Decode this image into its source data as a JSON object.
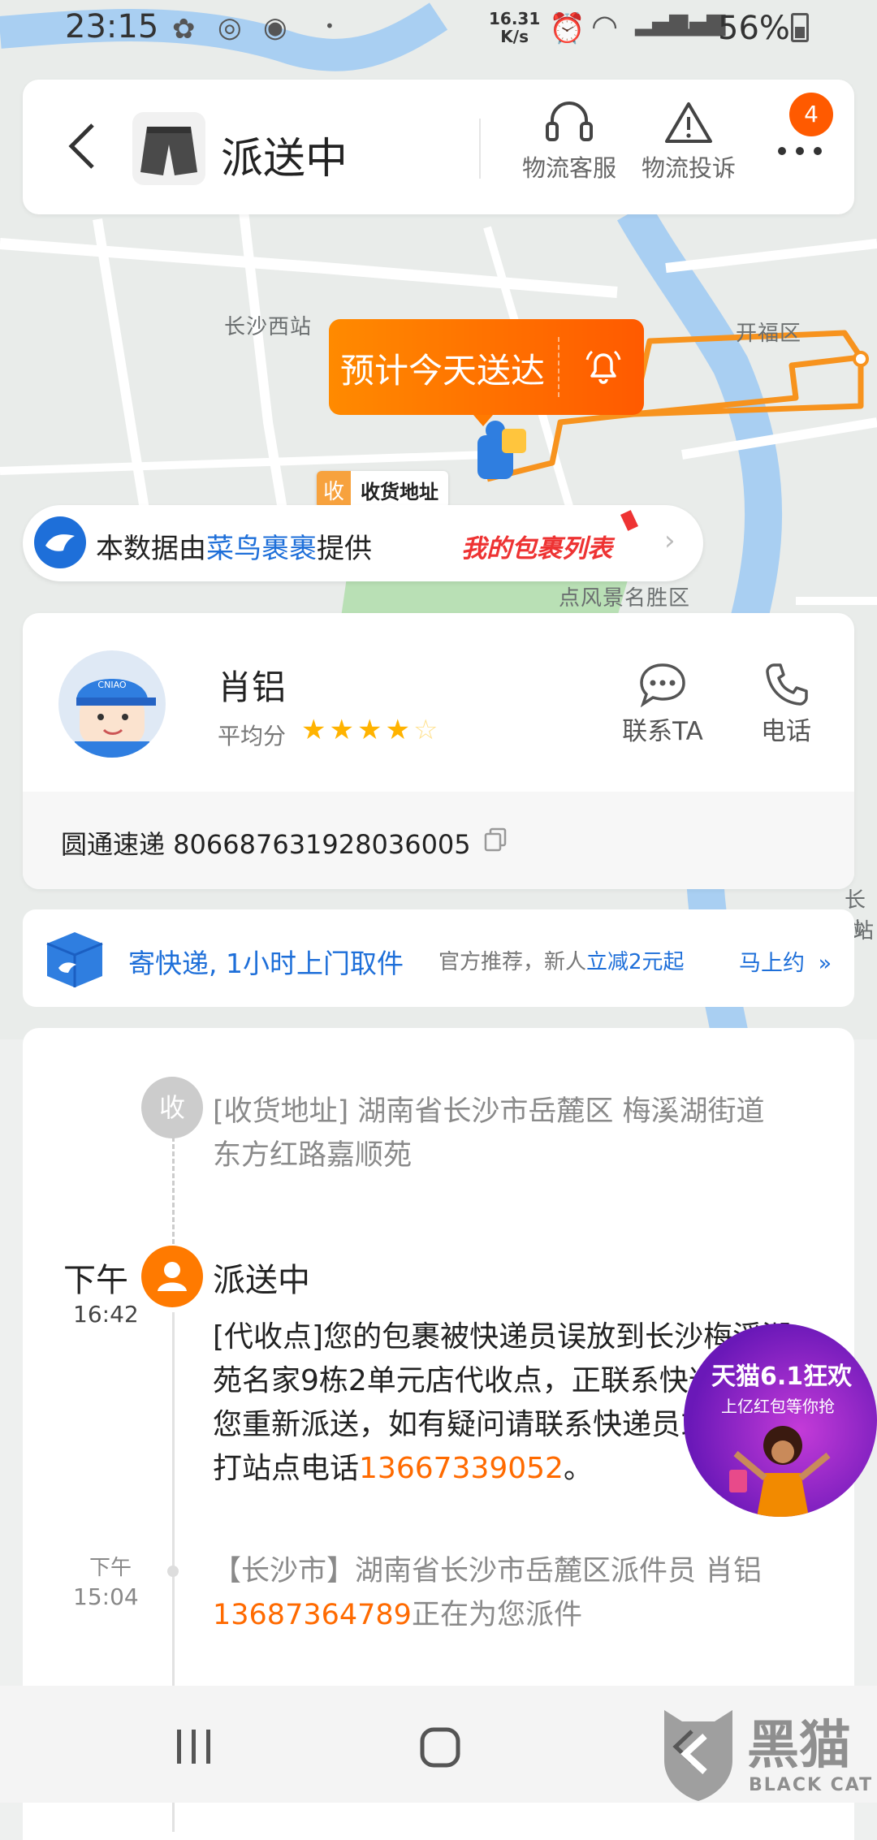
{
  "status_bar": {
    "time": "23:15",
    "net_speed_value": "16.31",
    "net_speed_unit": "K/s",
    "battery": "56%"
  },
  "header": {
    "title": "派送中",
    "service_label": "物流客服",
    "complaint_label": "物流投诉",
    "more_badge": "4"
  },
  "map": {
    "labels": [
      "长沙西站",
      "开福区",
      "点风景名胜区",
      "长沙",
      "站"
    ],
    "eta_text": "预计今天送达",
    "destination_marker_char": "收",
    "destination_marker_label": "收货地址",
    "route_color": "#f7931e"
  },
  "provider": {
    "prefix": "本数据由",
    "provider_name": "菜鸟裹裹",
    "suffix": "提供",
    "my_parcels": "我的包裹列表"
  },
  "courier": {
    "name": "肖铝",
    "rating_label": "平均分",
    "stars_filled": 4,
    "stars_total": 5,
    "contact_label": "联系TA",
    "phone_label": "电话",
    "tracking": "圆通速递 806687631928036005"
  },
  "promo": {
    "main": "寄快递, 1小时上门取件",
    "sub_prefix": "官方推荐，新人",
    "sub_highlight": "立减2元起",
    "cta": "马上约"
  },
  "timeline": {
    "address": {
      "marker": "收",
      "line1": "[收货地址] 湖南省长沙市岳麓区 梅溪湖街道",
      "line2": "东方红路嘉顺苑"
    },
    "event1": {
      "period": "下午",
      "time": "16:42",
      "title": "派送中",
      "line1": "[代收点]您的包裹被快递员误放到长沙梅溪湖",
      "line2": "苑名家9栋2单元店代收点，正联系快递员为",
      "line3": "您重新派送，如有疑问请联系快递员或者拨",
      "line4_prefix": "打站点电话",
      "line4_phone": "13667339052",
      "line4_suffix": "。"
    },
    "event2": {
      "period": "下午",
      "time": "15:04",
      "line1": "【长沙市】湖南省长沙市岳麓区派件员 肖铝",
      "phone": "13687364789",
      "line2_suffix": "正在为您派件"
    }
  },
  "ad": {
    "line1": "天猫6.1狂欢",
    "line2": "上亿红包等你抢"
  },
  "watermark": {
    "text": "黑猫",
    "sub": "BLACK CAT"
  }
}
